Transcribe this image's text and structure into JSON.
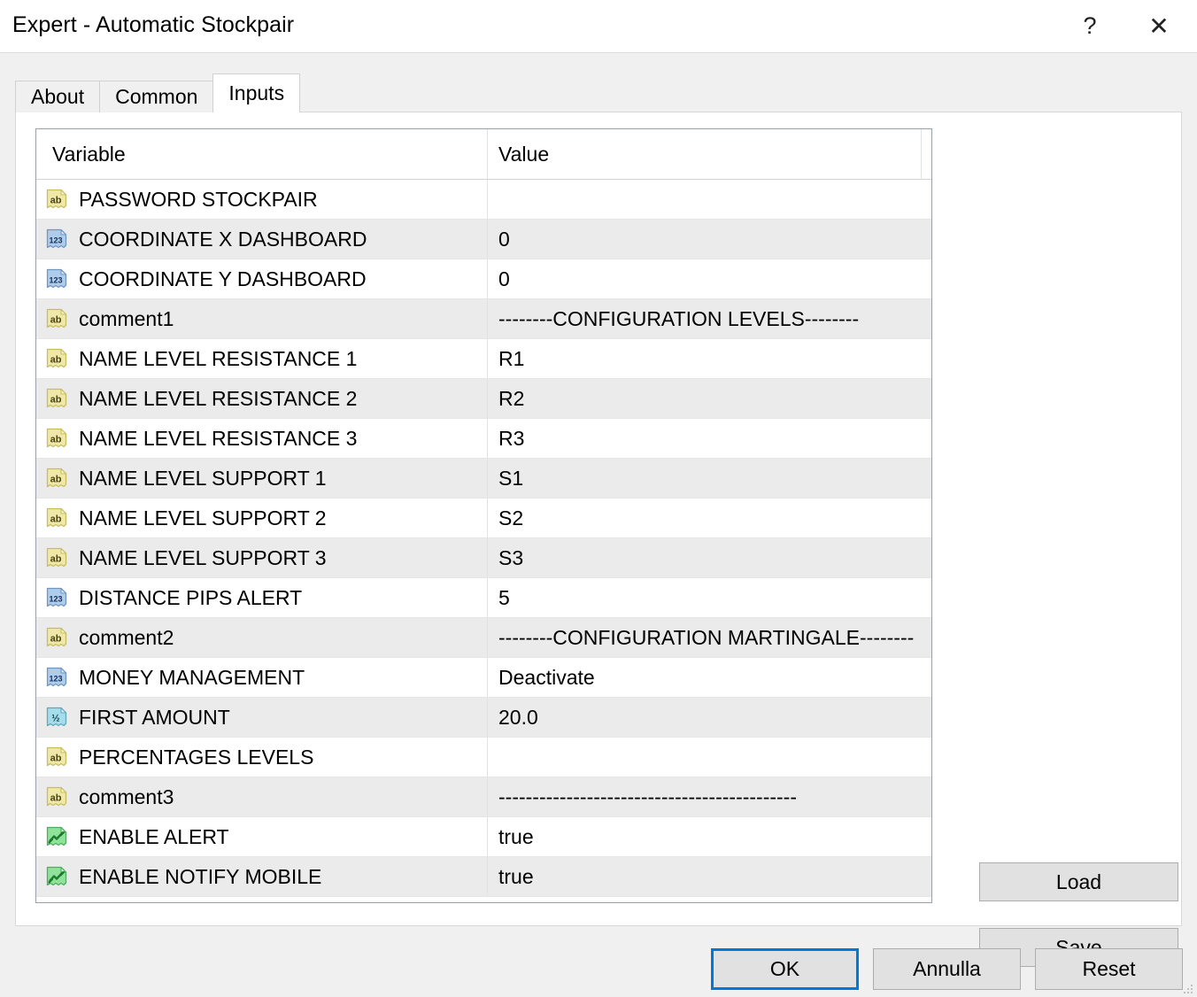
{
  "window": {
    "title": "Expert - Automatic Stockpair",
    "help_icon": "?",
    "close_icon": "✕"
  },
  "tabs": [
    {
      "label": "About",
      "active": false
    },
    {
      "label": "Common",
      "active": false
    },
    {
      "label": "Inputs",
      "active": true
    }
  ],
  "table": {
    "columns": [
      "Variable",
      "Value"
    ],
    "rows": [
      {
        "icon": "string-icon",
        "variable": "PASSWORD STOCKPAIR",
        "value": ""
      },
      {
        "icon": "integer-icon",
        "variable": "COORDINATE X DASHBOARD",
        "value": "0"
      },
      {
        "icon": "integer-icon",
        "variable": "COORDINATE Y DASHBOARD",
        "value": "0"
      },
      {
        "icon": "string-icon",
        "variable": "comment1",
        "value": "--------CONFIGURATION LEVELS--------"
      },
      {
        "icon": "string-icon",
        "variable": "NAME LEVEL RESISTANCE 1",
        "value": "R1"
      },
      {
        "icon": "string-icon",
        "variable": "NAME LEVEL RESISTANCE 2",
        "value": "R2"
      },
      {
        "icon": "string-icon",
        "variable": "NAME LEVEL RESISTANCE 3",
        "value": "R3"
      },
      {
        "icon": "string-icon",
        "variable": "NAME LEVEL SUPPORT 1",
        "value": "S1"
      },
      {
        "icon": "string-icon",
        "variable": "NAME LEVEL SUPPORT 2",
        "value": "S2"
      },
      {
        "icon": "string-icon",
        "variable": "NAME LEVEL SUPPORT 3",
        "value": "S3"
      },
      {
        "icon": "integer-icon",
        "variable": "DISTANCE PIPS ALERT",
        "value": "5"
      },
      {
        "icon": "string-icon",
        "variable": "comment2",
        "value": "--------CONFIGURATION MARTINGALE--------"
      },
      {
        "icon": "integer-icon",
        "variable": "MONEY MANAGEMENT",
        "value": "Deactivate"
      },
      {
        "icon": "double-icon",
        "variable": "FIRST AMOUNT",
        "value": "20.0"
      },
      {
        "icon": "string-icon",
        "variable": "PERCENTAGES LEVELS",
        "value": ""
      },
      {
        "icon": "string-icon",
        "variable": "comment3",
        "value": "--------------------------------------------"
      },
      {
        "icon": "boolean-icon",
        "variable": "ENABLE ALERT",
        "value": "true"
      },
      {
        "icon": "boolean-icon",
        "variable": "ENABLE NOTIFY MOBILE",
        "value": "true"
      }
    ]
  },
  "side_buttons": {
    "load": "Load",
    "save": "Save"
  },
  "footer_buttons": {
    "ok": "OK",
    "cancel": "Annulla",
    "reset": "Reset"
  },
  "colors": {
    "focus_border": "#0078D7",
    "dialog_bg": "#F0F0F0",
    "row_alt": "#EBEBEB",
    "string_icon": "#E8E0A0",
    "integer_icon": "#A8C8E8",
    "double_icon": "#A0DCE8",
    "boolean_icon": "#8CE096"
  }
}
